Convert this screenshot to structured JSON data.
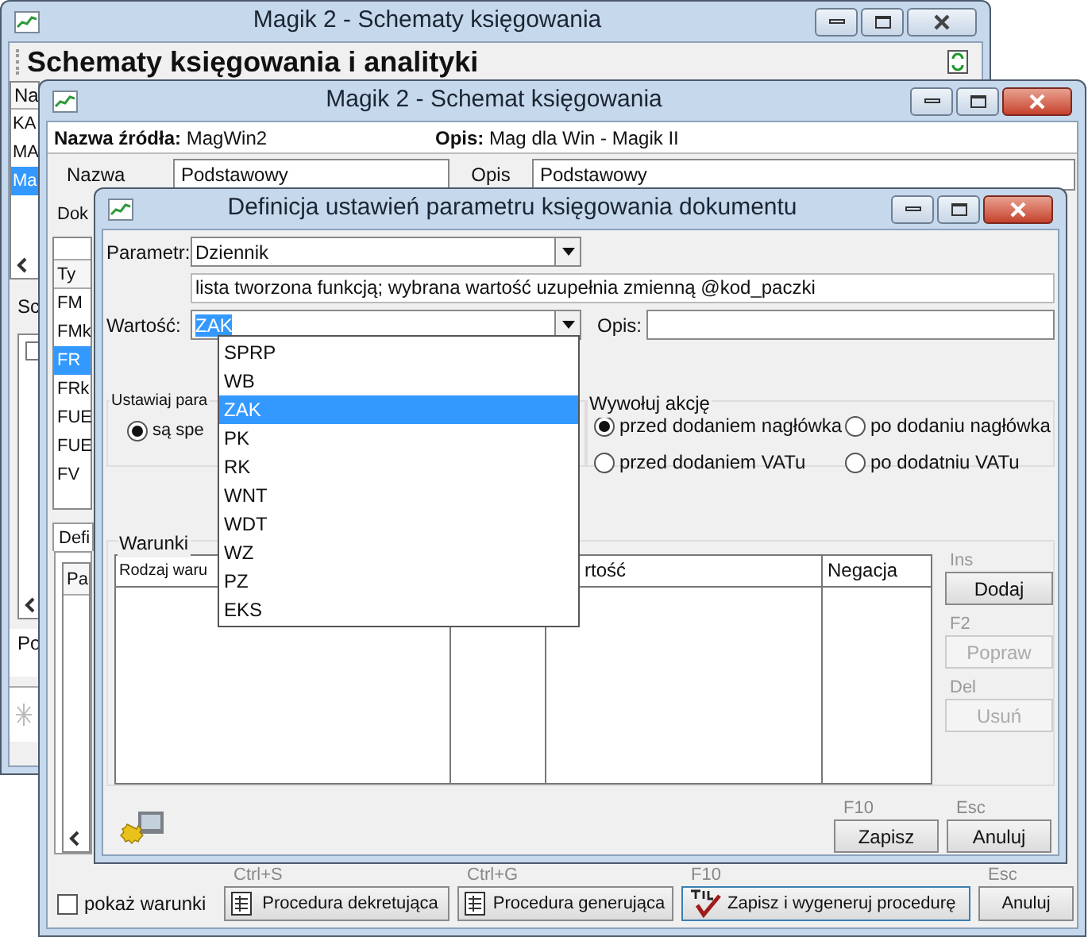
{
  "back_window": {
    "title": "Magik 2 - Schematy księgowania",
    "heading": "Schematy księgowania i analityki",
    "list_header": "Na",
    "list_items": [
      {
        "text": "KA",
        "selected": false
      },
      {
        "text": "MA",
        "selected": false
      },
      {
        "text": "Ma",
        "selected": true
      }
    ],
    "section_label": "Sc",
    "footer_label": "Po"
  },
  "schema_window": {
    "title": "Magik 2 - Schemat księgowania",
    "source_label": "Nazwa źródła:",
    "source_value": "MagWin2",
    "desc_label": "Opis:",
    "desc_value": "Mag dla Win - Magik II",
    "name_label": "Nazwa",
    "name_value": "Podstawowy",
    "opis_label": "Opis",
    "opis_value": "Podstawowy",
    "doc_label": "Dok",
    "type_header": "Ty",
    "types": [
      {
        "text": "FM",
        "selected": false
      },
      {
        "text": "FMk",
        "selected": false
      },
      {
        "text": "FR",
        "selected": true
      },
      {
        "text": "FRk",
        "selected": false
      },
      {
        "text": "FUE",
        "selected": false
      },
      {
        "text": "FUE",
        "selected": false
      },
      {
        "text": "FV",
        "selected": false
      }
    ],
    "tab": "Defi",
    "param_header": "Pa",
    "show_conditions": {
      "label": "pokaż warunki",
      "checked": false
    },
    "buttons": [
      {
        "shortcut": "Ctrl+S",
        "label": "Procedura dekretująca",
        "kind": "document",
        "focused": false
      },
      {
        "shortcut": "Ctrl+G",
        "label": "Procedura generująca",
        "kind": "document",
        "focused": false
      },
      {
        "shortcut": "F10",
        "label": "Zapisz i wygeneruj procedurę",
        "kind": "sql",
        "focused": true
      },
      {
        "shortcut": "Esc",
        "label": "Anuluj",
        "kind": "plain",
        "focused": false
      }
    ]
  },
  "dialog": {
    "title": "Definicja ustawień parametru księgowania dokumentu",
    "param_label": "Parametr:",
    "param_value": "Dziennik",
    "hint": "lista tworzona funkcją; wybrana wartość uzupełnia zmienną @kod_paczki",
    "value_label": "Wartość:",
    "value": "ZAK",
    "opis_label": "Opis:",
    "options": [
      {
        "text": "SPRP",
        "selected": false
      },
      {
        "text": "WB",
        "selected": false
      },
      {
        "text": "ZAK",
        "selected": true
      },
      {
        "text": "PK",
        "selected": false
      },
      {
        "text": "RK",
        "selected": false
      },
      {
        "text": "WNT",
        "selected": false
      },
      {
        "text": "WDT",
        "selected": false
      },
      {
        "text": "WZ",
        "selected": false
      },
      {
        "text": "PZ",
        "selected": false
      },
      {
        "text": "EKS",
        "selected": false
      }
    ],
    "set_group": {
      "legend": "Ustawiaj para",
      "options": [
        {
          "label": "są spe",
          "selected": true
        }
      ]
    },
    "action_group": {
      "legend": "Wywołuj akcję",
      "options": [
        {
          "label": "przed dodaniem nagłówka",
          "selected": true
        },
        {
          "label": "po dodaniu nagłówka",
          "selected": false
        },
        {
          "label": "przed dodaniem VATu",
          "selected": false
        },
        {
          "label": "po dodatniu VATu",
          "selected": false
        }
      ]
    },
    "conditions": {
      "legend": "Warunki",
      "columns": [
        "Rodzaj waru",
        "rtość",
        "Negacja"
      ],
      "buttons": [
        {
          "shortcut": "Ins",
          "label": "Dodaj",
          "disabled": false
        },
        {
          "shortcut": "F2",
          "label": "Popraw",
          "disabled": true
        },
        {
          "shortcut": "Del",
          "label": "Usuń",
          "disabled": true
        }
      ]
    },
    "footer_buttons": [
      {
        "shortcut": "F10",
        "label": "Zapisz"
      },
      {
        "shortcut": "Esc",
        "label": "Anuluj"
      }
    ]
  }
}
